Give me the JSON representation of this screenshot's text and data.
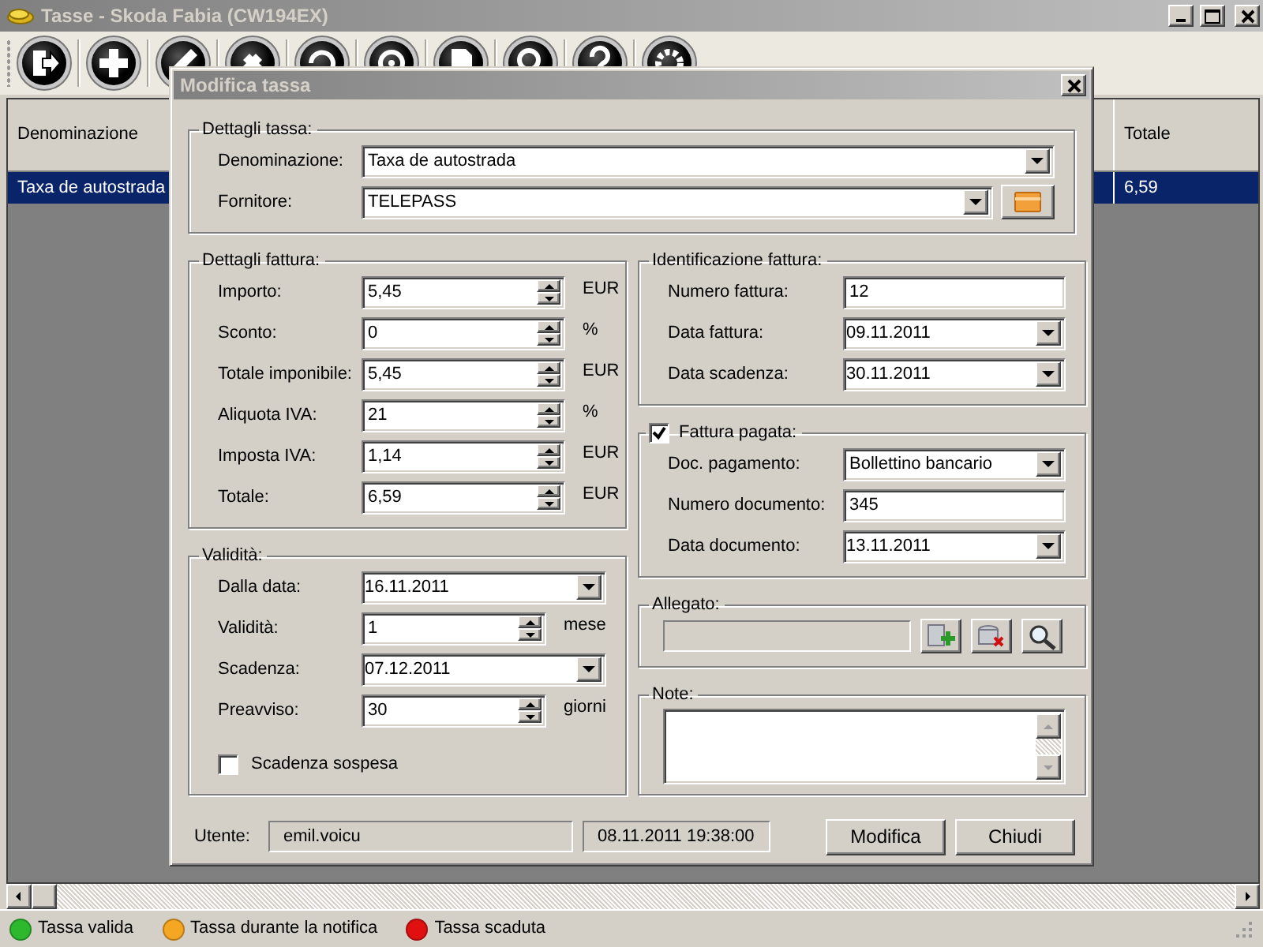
{
  "window": {
    "title": "Tasse - Skoda Fabia (CW194EX)"
  },
  "grid": {
    "columns": [
      {
        "label": "Denominazione"
      },
      {
        "label": "Totale"
      }
    ],
    "rows": [
      {
        "cells": [
          "Taxa de autostrada",
          "6,59"
        ],
        "selected": true
      }
    ]
  },
  "dialog": {
    "title": "Modifica tassa",
    "top_section": {
      "kind": "form",
      "legend": "Dettagli tassa:",
      "fields": [
        {
          "kind": "combo",
          "label": "Denominazione:",
          "value": "Taxa de autostrada"
        },
        {
          "kind": "combo-button",
          "label": "Fornitore:",
          "value": "TELEPASS"
        }
      ]
    },
    "left_sections": [
      {
        "kind": "form",
        "legend": "Dettagli fattura:",
        "fields": [
          {
            "kind": "spin",
            "label": "Importo:",
            "value": "5,45",
            "unit": "EUR"
          },
          {
            "kind": "spin",
            "label": "Sconto:",
            "value": "0",
            "unit": "%"
          },
          {
            "kind": "spin",
            "label": "Totale imponibile:",
            "value": "5,45",
            "unit": "EUR"
          },
          {
            "kind": "spin",
            "label": "Aliquota IVA:",
            "value": "21",
            "unit": "%"
          },
          {
            "kind": "spin",
            "label": "Imposta IVA:",
            "value": "1,14",
            "unit": "EUR"
          },
          {
            "kind": "spin",
            "label": "Totale:",
            "value": "6,59",
            "unit": "EUR"
          }
        ]
      },
      {
        "kind": "form",
        "legend": "Validità:",
        "fields": [
          {
            "kind": "date",
            "label": "Dalla data:",
            "value": "16.11.2011"
          },
          {
            "kind": "spin",
            "label": "Validità:",
            "value": "1",
            "unit": "mese"
          },
          {
            "kind": "date",
            "label": "Scadenza:",
            "value": "07.12.2011"
          },
          {
            "kind": "spin",
            "label": "Preavviso:",
            "value": "30",
            "unit": "giorni"
          },
          {
            "kind": "check",
            "label": "Scadenza sospesa",
            "checked": false
          }
        ]
      }
    ],
    "right_sections": [
      {
        "kind": "form",
        "legend": "Identificazione fattura:",
        "fields": [
          {
            "kind": "text",
            "label": "Numero fattura:",
            "value": "12"
          },
          {
            "kind": "date",
            "label": "Data fattura:",
            "value": "09.11.2011"
          },
          {
            "kind": "date",
            "label": "Data scadenza:",
            "value": "30.11.2011"
          }
        ]
      },
      {
        "kind": "form",
        "legend": "Fattura pagata:",
        "checked": true,
        "fields": [
          {
            "kind": "combo",
            "label": "Doc. pagamento:",
            "value": "Bollettino bancario"
          },
          {
            "kind": "text",
            "label": "Numero documento:",
            "value": "345"
          },
          {
            "kind": "date",
            "label": "Data documento:",
            "value": "13.11.2011"
          }
        ]
      },
      {
        "kind": "attachment",
        "legend": "Allegato:"
      },
      {
        "kind": "memo",
        "legend": "Note:"
      }
    ],
    "footer": {
      "user_label": "Utente:",
      "user": "emil.voicu",
      "timestamp": "08.11.2011 19:38:00",
      "buttons": [
        "Modifica",
        "Chiudi"
      ]
    }
  },
  "status_bar": {
    "items": [
      {
        "label": "Tassa valida",
        "color": "#2eb82e"
      },
      {
        "label": "Tassa durante la notifica",
        "color": "#f5a623"
      },
      {
        "label": "Tassa scaduta",
        "color": "#e01010"
      }
    ]
  }
}
